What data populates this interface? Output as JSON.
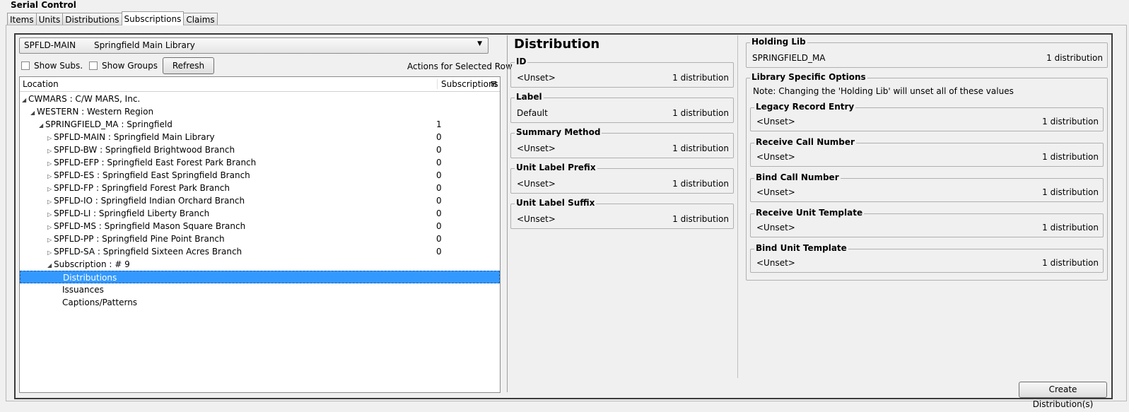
{
  "app": {
    "title": "Serial Control"
  },
  "tabs": [
    {
      "label": "Items"
    },
    {
      "label": "Units"
    },
    {
      "label": "Distributions"
    },
    {
      "label": "Subscriptions"
    },
    {
      "label": "Claims"
    }
  ],
  "location_select": {
    "code": "SPFLD-MAIN",
    "name": "Springfield Main Library"
  },
  "controls": {
    "show_subs": "Show Subs.",
    "show_groups": "Show Groups",
    "refresh": "Refresh",
    "actions": "Actions for Selected Row"
  },
  "tree": {
    "col_location": "Location",
    "col_subscriptions": "Subscriptions",
    "rows": [
      {
        "label": "CWMARS : C/W MARS, Inc.",
        "count": ""
      },
      {
        "label": "WESTERN : Western Region",
        "count": ""
      },
      {
        "label": "SPRINGFIELD_MA : Springfield",
        "count": "1"
      },
      {
        "label": "SPFLD-MAIN : Springfield Main Library",
        "count": "0"
      },
      {
        "label": "SPFLD-BW : Springfield Brightwood Branch",
        "count": "0"
      },
      {
        "label": "SPFLD-EFP : Springfield East Forest Park Branch",
        "count": "0"
      },
      {
        "label": "SPFLD-ES : Springfield East Springfield Branch",
        "count": "0"
      },
      {
        "label": "SPFLD-FP : Springfield Forest Park Branch",
        "count": "0"
      },
      {
        "label": "SPFLD-IO : Springfield Indian Orchard Branch",
        "count": "0"
      },
      {
        "label": "SPFLD-LI : Springfield Liberty Branch",
        "count": "0"
      },
      {
        "label": "SPFLD-MS : Springfield Mason Square Branch",
        "count": "0"
      },
      {
        "label": "SPFLD-PP : Springfield Pine Point Branch",
        "count": "0"
      },
      {
        "label": "SPFLD-SA : Springfield Sixteen Acres Branch",
        "count": "0"
      },
      {
        "label": "Subscription : # 9",
        "count": ""
      },
      {
        "label": "Distributions",
        "count": ""
      },
      {
        "label": "Issuances",
        "count": ""
      },
      {
        "label": "Captions/Patterns",
        "count": ""
      }
    ]
  },
  "distribution": {
    "title": "Distribution",
    "fields": [
      {
        "legend": "ID",
        "value": "<Unset>",
        "count": "1 distribution"
      },
      {
        "legend": "Label",
        "value": "Default",
        "count": "1 distribution"
      },
      {
        "legend": "Summary Method",
        "value": "<Unset>",
        "count": "1 distribution"
      },
      {
        "legend": "Unit Label Prefix",
        "value": "<Unset>",
        "count": "1 distribution"
      },
      {
        "legend": "Unit Label Suffix",
        "value": "<Unset>",
        "count": "1 distribution"
      }
    ]
  },
  "holding": {
    "legend": "Holding Lib",
    "value": "SPRINGFIELD_MA",
    "count": "1 distribution"
  },
  "library_options": {
    "legend": "Library Specific Options",
    "note": "Note: Changing the 'Holding Lib' will unset all of these values",
    "fields": [
      {
        "legend": "Legacy Record Entry",
        "value": "<Unset>",
        "count": "1 distribution"
      },
      {
        "legend": "Receive Call Number",
        "value": "<Unset>",
        "count": "1 distribution"
      },
      {
        "legend": "Bind Call Number",
        "value": "<Unset>",
        "count": "1 distribution"
      },
      {
        "legend": "Receive Unit Template",
        "value": "<Unset>",
        "count": "1 distribution"
      },
      {
        "legend": "Bind Unit Template",
        "value": "<Unset>",
        "count": "1 distribution"
      }
    ]
  },
  "create_button": "Create Distribution(s)"
}
